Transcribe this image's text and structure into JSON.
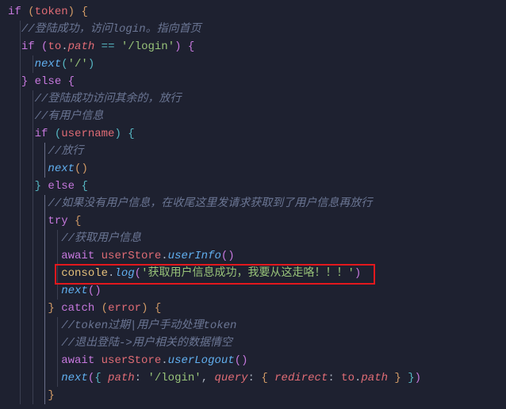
{
  "code": {
    "lines": [
      {
        "indent": 0,
        "tokens": [
          {
            "t": "kw",
            "v": "if"
          },
          {
            "t": "punc",
            "v": " "
          },
          {
            "t": "brace-y",
            "v": "("
          },
          {
            "t": "var",
            "v": "token"
          },
          {
            "t": "brace-y",
            "v": ")"
          },
          {
            "t": "punc",
            "v": " "
          },
          {
            "t": "brace-y",
            "v": "{"
          }
        ]
      },
      {
        "indent": 1,
        "tokens": [
          {
            "t": "cm",
            "v": "//登陆成功，访问login。指向首页"
          }
        ]
      },
      {
        "indent": 1,
        "tokens": [
          {
            "t": "kw",
            "v": "if"
          },
          {
            "t": "punc",
            "v": " "
          },
          {
            "t": "brace-p",
            "v": "("
          },
          {
            "t": "var",
            "v": "to"
          },
          {
            "t": "punc",
            "v": "."
          },
          {
            "t": "prop",
            "v": "path"
          },
          {
            "t": "punc",
            "v": " "
          },
          {
            "t": "op",
            "v": "=="
          },
          {
            "t": "punc",
            "v": " "
          },
          {
            "t": "str",
            "v": "'/login'"
          },
          {
            "t": "brace-p",
            "v": ")"
          },
          {
            "t": "punc",
            "v": " "
          },
          {
            "t": "brace-p",
            "v": "{"
          }
        ]
      },
      {
        "indent": 2,
        "tokens": [
          {
            "t": "fn",
            "v": "next"
          },
          {
            "t": "brace-b",
            "v": "("
          },
          {
            "t": "str",
            "v": "'/'"
          },
          {
            "t": "brace-b",
            "v": ")"
          }
        ]
      },
      {
        "indent": 1,
        "tokens": [
          {
            "t": "brace-p",
            "v": "}"
          },
          {
            "t": "punc",
            "v": " "
          },
          {
            "t": "kw",
            "v": "else"
          },
          {
            "t": "punc",
            "v": " "
          },
          {
            "t": "brace-p",
            "v": "{"
          }
        ]
      },
      {
        "indent": 2,
        "tokens": [
          {
            "t": "cm",
            "v": "//登陆成功访问其余的，放行"
          }
        ]
      },
      {
        "indent": 2,
        "tokens": [
          {
            "t": "cm",
            "v": "//有用户信息"
          }
        ]
      },
      {
        "indent": 2,
        "tokens": [
          {
            "t": "kw",
            "v": "if"
          },
          {
            "t": "punc",
            "v": " "
          },
          {
            "t": "brace-b",
            "v": "("
          },
          {
            "t": "var",
            "v": "username"
          },
          {
            "t": "brace-b",
            "v": ")"
          },
          {
            "t": "punc",
            "v": " "
          },
          {
            "t": "brace-b",
            "v": "{"
          }
        ]
      },
      {
        "indent": 3,
        "tokens": [
          {
            "t": "cm",
            "v": "//放行"
          }
        ]
      },
      {
        "indent": 3,
        "tokens": [
          {
            "t": "fn",
            "v": "next"
          },
          {
            "t": "brace-y",
            "v": "("
          },
          {
            "t": "brace-y",
            "v": ")"
          }
        ]
      },
      {
        "indent": 2,
        "tokens": [
          {
            "t": "brace-b",
            "v": "}"
          },
          {
            "t": "punc",
            "v": " "
          },
          {
            "t": "kw",
            "v": "else"
          },
          {
            "t": "punc",
            "v": " "
          },
          {
            "t": "brace-b",
            "v": "{"
          }
        ]
      },
      {
        "indent": 3,
        "tokens": [
          {
            "t": "cm",
            "v": "//如果没有用户信息，在收尾这里发请求获取到了用户信息再放行"
          }
        ]
      },
      {
        "indent": 3,
        "tokens": [
          {
            "t": "kw",
            "v": "try"
          },
          {
            "t": "punc",
            "v": " "
          },
          {
            "t": "brace-y",
            "v": "{"
          }
        ]
      },
      {
        "indent": 4,
        "tokens": [
          {
            "t": "cm",
            "v": "//获取用户信息"
          }
        ]
      },
      {
        "indent": 4,
        "tokens": [
          {
            "t": "kw",
            "v": "await"
          },
          {
            "t": "punc",
            "v": " "
          },
          {
            "t": "var",
            "v": "userStore"
          },
          {
            "t": "punc",
            "v": "."
          },
          {
            "t": "fn",
            "v": "userInfo"
          },
          {
            "t": "brace-p",
            "v": "("
          },
          {
            "t": "brace-p",
            "v": ")"
          }
        ]
      },
      {
        "indent": 4,
        "tokens": [
          {
            "t": "obj",
            "v": "console"
          },
          {
            "t": "punc",
            "v": "."
          },
          {
            "t": "fn",
            "v": "log"
          },
          {
            "t": "brace-p",
            "v": "("
          },
          {
            "t": "str",
            "v": "'获取用户信息成功，我要从这走咯！！！'"
          },
          {
            "t": "brace-p",
            "v": ")"
          }
        ]
      },
      {
        "indent": 4,
        "tokens": [
          {
            "t": "fn",
            "v": "next"
          },
          {
            "t": "brace-p",
            "v": "("
          },
          {
            "t": "brace-p",
            "v": ")"
          }
        ]
      },
      {
        "indent": 3,
        "tokens": [
          {
            "t": "brace-y",
            "v": "}"
          },
          {
            "t": "punc",
            "v": " "
          },
          {
            "t": "kw",
            "v": "catch"
          },
          {
            "t": "punc",
            "v": " "
          },
          {
            "t": "brace-y",
            "v": "("
          },
          {
            "t": "var",
            "v": "error"
          },
          {
            "t": "brace-y",
            "v": ")"
          },
          {
            "t": "punc",
            "v": " "
          },
          {
            "t": "brace-y",
            "v": "{"
          }
        ]
      },
      {
        "indent": 4,
        "tokens": [
          {
            "t": "cm",
            "v": "//token过期|用户手动处理token"
          }
        ]
      },
      {
        "indent": 4,
        "tokens": [
          {
            "t": "cm",
            "v": "//退出登陆->用户相关的数据情空"
          }
        ]
      },
      {
        "indent": 4,
        "tokens": [
          {
            "t": "kw",
            "v": "await"
          },
          {
            "t": "punc",
            "v": " "
          },
          {
            "t": "var",
            "v": "userStore"
          },
          {
            "t": "punc",
            "v": "."
          },
          {
            "t": "fn",
            "v": "userLogout"
          },
          {
            "t": "brace-p",
            "v": "("
          },
          {
            "t": "brace-p",
            "v": ")"
          }
        ]
      },
      {
        "indent": 4,
        "tokens": [
          {
            "t": "fn",
            "v": "next"
          },
          {
            "t": "brace-p",
            "v": "("
          },
          {
            "t": "brace-b",
            "v": "{"
          },
          {
            "t": "punc",
            "v": " "
          },
          {
            "t": "prop",
            "v": "path"
          },
          {
            "t": "punc",
            "v": ": "
          },
          {
            "t": "str",
            "v": "'/login'"
          },
          {
            "t": "punc",
            "v": ", "
          },
          {
            "t": "prop",
            "v": "query"
          },
          {
            "t": "punc",
            "v": ": "
          },
          {
            "t": "brace-y",
            "v": "{"
          },
          {
            "t": "punc",
            "v": " "
          },
          {
            "t": "prop",
            "v": "redirect"
          },
          {
            "t": "punc",
            "v": ": "
          },
          {
            "t": "var",
            "v": "to"
          },
          {
            "t": "punc",
            "v": "."
          },
          {
            "t": "prop",
            "v": "path"
          },
          {
            "t": "punc",
            "v": " "
          },
          {
            "t": "brace-y",
            "v": "}"
          },
          {
            "t": "punc",
            "v": " "
          },
          {
            "t": "brace-b",
            "v": "}"
          },
          {
            "t": "brace-p",
            "v": ")"
          }
        ]
      },
      {
        "indent": 3,
        "tokens": [
          {
            "t": "brace-y",
            "v": "}"
          }
        ]
      }
    ],
    "highlight_line": 15,
    "indent_unit": "  ",
    "indent_bars": [
      {
        "col": 1,
        "from": 1,
        "to": 22
      },
      {
        "col": 2,
        "from": 3,
        "to": 3
      },
      {
        "col": 2,
        "from": 5,
        "to": 22
      },
      {
        "col": 3,
        "from": 8,
        "to": 9,
        "active": true
      },
      {
        "col": 3,
        "from": 11,
        "to": 22,
        "active": true
      },
      {
        "col": 4,
        "from": 13,
        "to": 16
      },
      {
        "col": 4,
        "from": 18,
        "to": 21
      }
    ]
  }
}
